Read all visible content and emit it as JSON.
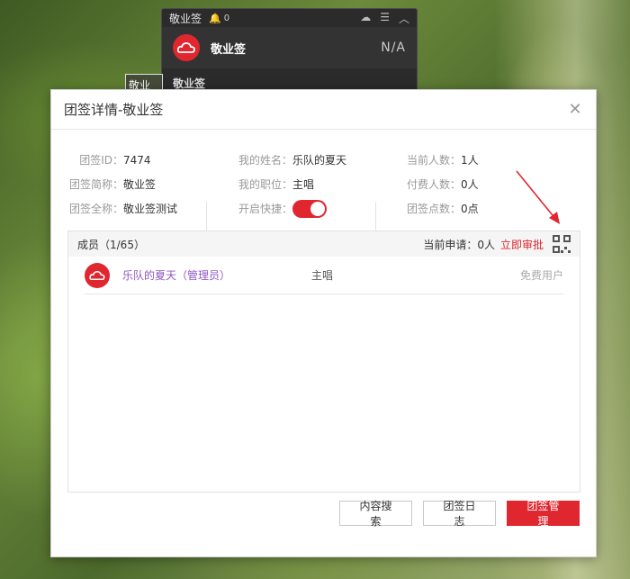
{
  "widget": {
    "title": "敬业签",
    "bell_count": "0",
    "group_name": "敬业签",
    "value": "N/A",
    "row2_text": "敬业签"
  },
  "desktop_chip": "敬业签",
  "dialog": {
    "title": "团签详情-敬业签",
    "info": {
      "col1": [
        {
          "label": "团签ID：",
          "value": "7474"
        },
        {
          "label": "团签简称：",
          "value": "敬业签"
        },
        {
          "label": "团签全称：",
          "value": "敬业签测试"
        }
      ],
      "col2": [
        {
          "label": "我的姓名：",
          "value": "乐队的夏天"
        },
        {
          "label": "我的职位：",
          "value": "主唱"
        },
        {
          "label": "开启快捷：",
          "value": ""
        }
      ],
      "col3": [
        {
          "label": "当前人数：",
          "value": "1人"
        },
        {
          "label": "付费人数：",
          "value": "0人"
        },
        {
          "label": "团签点数：",
          "value": "0点"
        }
      ]
    },
    "members": {
      "header": "成员（1/65）",
      "apply_label": "当前申请：0人",
      "apply_link": "立即审批",
      "rows": [
        {
          "name": "乐队的夏天（管理员）",
          "role": "主唱",
          "type": "免费用户"
        }
      ]
    },
    "buttons": {
      "search": "内容搜索",
      "log": "团签日志",
      "manage": "团签管理"
    }
  },
  "colors": {
    "accent": "#e0262f",
    "member_name": "#8e57c4"
  }
}
